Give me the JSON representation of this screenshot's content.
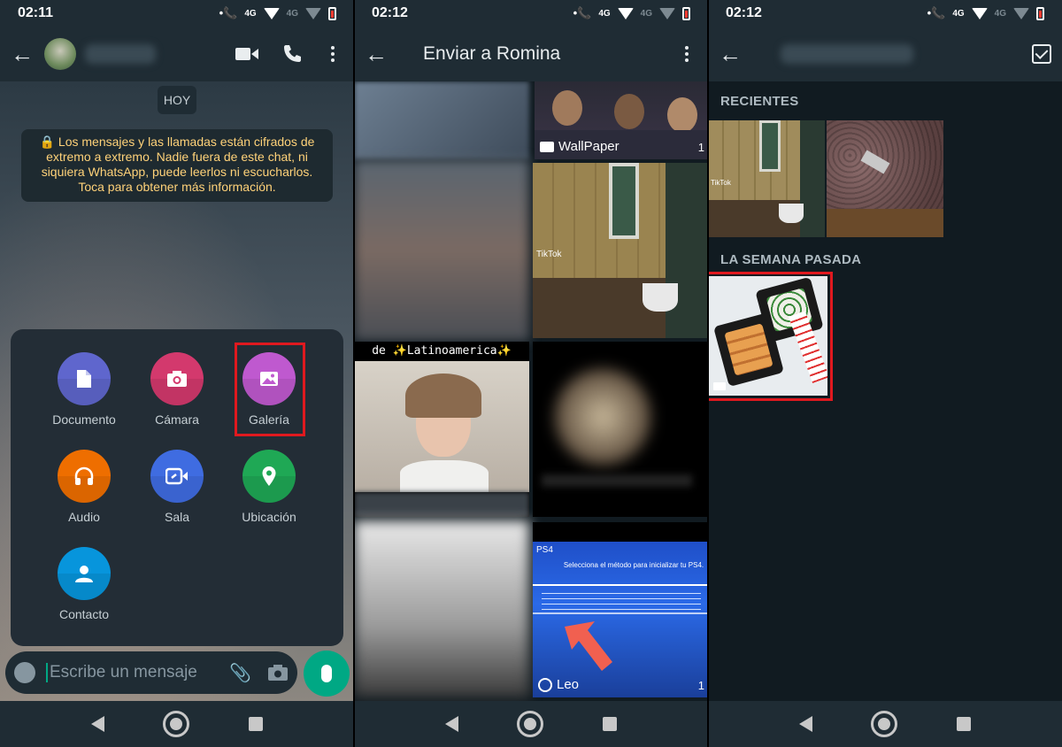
{
  "panel1": {
    "status": {
      "time": "02:11",
      "net": "4G",
      "net2": "4G"
    },
    "chat": {
      "date_badge": "HOY",
      "encryption_notice": "🔒 Los mensajes y las llamadas están cifrados de extremo a extremo. Nadie fuera de este chat, ni siquiera WhatsApp, puede leerlos ni escucharlos. Toca para obtener más información."
    },
    "attach_menu": [
      {
        "label": "Documento",
        "color": "#5f66cd",
        "icon": "document-icon"
      },
      {
        "label": "Cámara",
        "color": "#d3396d",
        "icon": "camera-icon"
      },
      {
        "label": "Galería",
        "color": "#bf59cf",
        "icon": "image-icon"
      },
      {
        "label": "Audio",
        "color": "#ee6e00",
        "icon": "headphones-icon"
      },
      {
        "label": "Sala",
        "color": "#3f6ce1",
        "icon": "video-link-icon"
      },
      {
        "label": "Ubicación",
        "color": "#1fa855",
        "icon": "location-pin-icon"
      },
      {
        "label": "Contacto",
        "color": "#0795dc",
        "icon": "person-icon"
      }
    ],
    "input": {
      "placeholder": "Escribe un mensaje"
    }
  },
  "panel2": {
    "status": {
      "time": "02:12",
      "net": "4G",
      "net2": "4G"
    },
    "title": "Enviar a Romina",
    "albums": [
      {
        "name": "WallPaper",
        "count": "1"
      },
      {
        "name": "Leo",
        "count": "1"
      }
    ],
    "ps4_text": "Selecciona el método para inicializar tu PS4.",
    "tiktok_label": "TikTok",
    "latam_caption": "Latinoamerica"
  },
  "panel3": {
    "status": {
      "time": "02:12",
      "net": "4G",
      "net2": "4G"
    },
    "sections": {
      "recent": "RECIENTES",
      "last_week": "LA SEMANA PASADA"
    },
    "tiktok_label": "TikTok"
  },
  "colors": {
    "accent": "#00a884",
    "highlight": "#e0191f",
    "bar": "#1f2c34"
  }
}
